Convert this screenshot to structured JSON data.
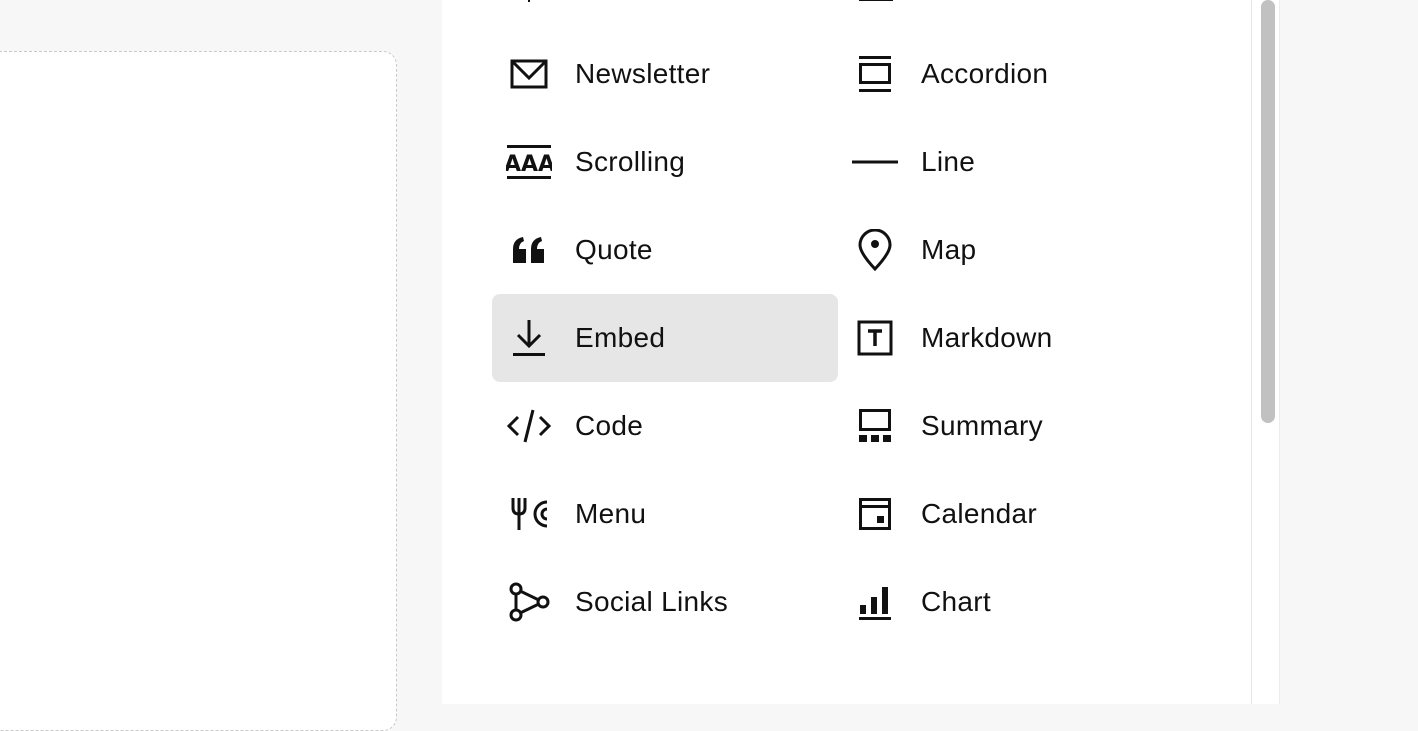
{
  "panel": {
    "left_column": [
      {
        "label": "Newsletter",
        "icon": "envelope-icon"
      },
      {
        "label": "Scrolling",
        "icon": "scrolling-text-icon"
      },
      {
        "label": "Quote",
        "icon": "quote-icon"
      },
      {
        "label": "Embed",
        "icon": "download-arrow-icon",
        "active": true
      },
      {
        "label": "Code",
        "icon": "code-icon"
      },
      {
        "label": "Menu",
        "icon": "fork-plate-icon"
      },
      {
        "label": "Social Links",
        "icon": "share-nodes-icon"
      }
    ],
    "right_column": [
      {
        "label": "Accordion",
        "icon": "accordion-icon"
      },
      {
        "label": "Line",
        "icon": "line-icon"
      },
      {
        "label": "Map",
        "icon": "map-pin-icon"
      },
      {
        "label": "Markdown",
        "icon": "text-box-icon"
      },
      {
        "label": "Summary",
        "icon": "summary-grid-icon"
      },
      {
        "label": "Calendar",
        "icon": "calendar-icon"
      },
      {
        "label": "Chart",
        "icon": "bar-chart-icon"
      }
    ]
  },
  "colors": {
    "active_bg": "#e6e6e6",
    "text": "#111111",
    "scrollbar_thumb": "#c1c1c1",
    "placeholder_border": "#c9c9c9"
  }
}
